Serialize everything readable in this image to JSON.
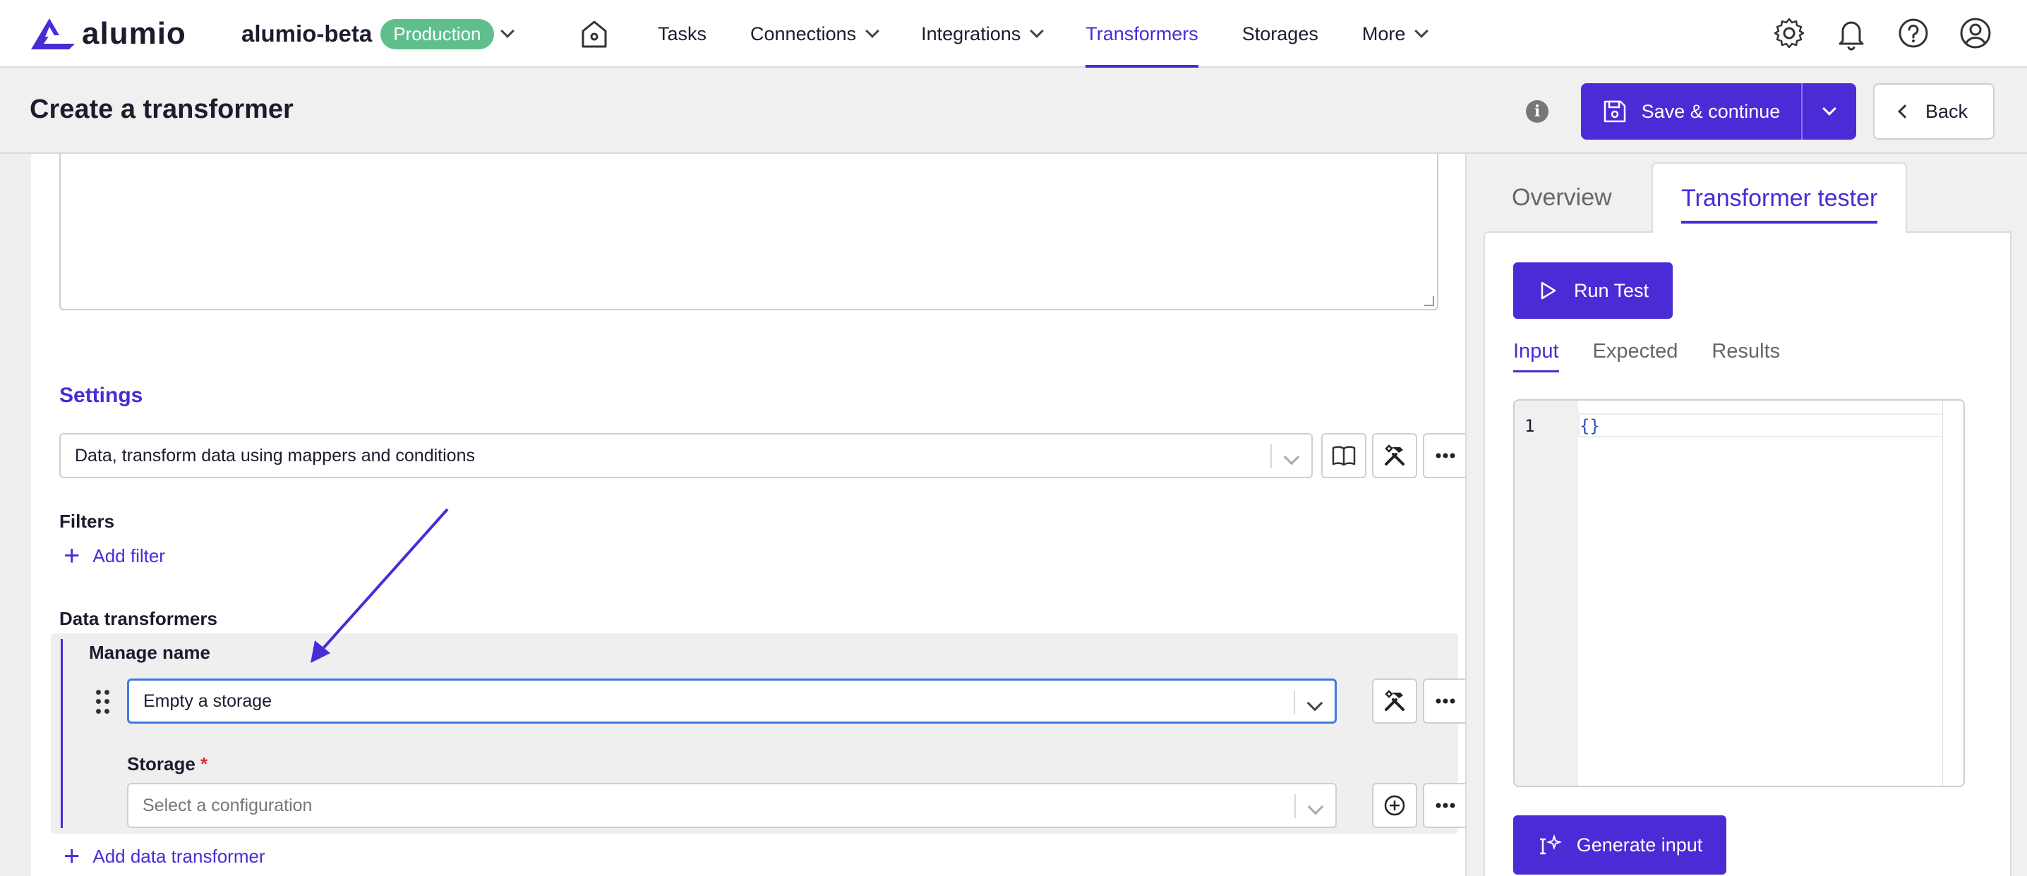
{
  "brand": {
    "logo_text": "alumio",
    "environment": "alumio-beta",
    "env_badge": "Production"
  },
  "nav": {
    "items": [
      {
        "label": "Tasks",
        "dropdown": false,
        "active": false
      },
      {
        "label": "Connections",
        "dropdown": true,
        "active": false
      },
      {
        "label": "Integrations",
        "dropdown": true,
        "active": false
      },
      {
        "label": "Transformers",
        "dropdown": false,
        "active": true
      },
      {
        "label": "Storages",
        "dropdown": false,
        "active": false
      },
      {
        "label": "More",
        "dropdown": true,
        "active": false
      }
    ],
    "icons": [
      "gear-icon",
      "bell-icon",
      "help-icon",
      "user-icon"
    ]
  },
  "header": {
    "title": "Create a transformer",
    "save_label": "Save & continue",
    "back_label": "Back"
  },
  "form": {
    "settings_title": "Settings",
    "settings_value": "Data, transform data using mappers and conditions",
    "filters_label": "Filters",
    "add_filter_label": "Add filter",
    "data_transformers_label": "Data transformers",
    "transformer": {
      "name_label": "Manage name",
      "value": "Empty a storage",
      "storage_label": "Storage",
      "storage_required": "*",
      "storage_placeholder": "Select a configuration"
    },
    "add_data_transformer_label": "Add data transformer"
  },
  "tester": {
    "tabs": [
      "Overview",
      "Transformer tester"
    ],
    "active_tab": "Transformer tester",
    "run_label": "Run Test",
    "subtabs": [
      "Input",
      "Expected",
      "Results"
    ],
    "active_subtab": "Input",
    "line_number": "1",
    "code": "{}",
    "generate_label": "Generate input"
  },
  "colors": {
    "accent": "#4a2bd6",
    "badge": "#5fbf8c",
    "focus": "#3d7ae0"
  }
}
